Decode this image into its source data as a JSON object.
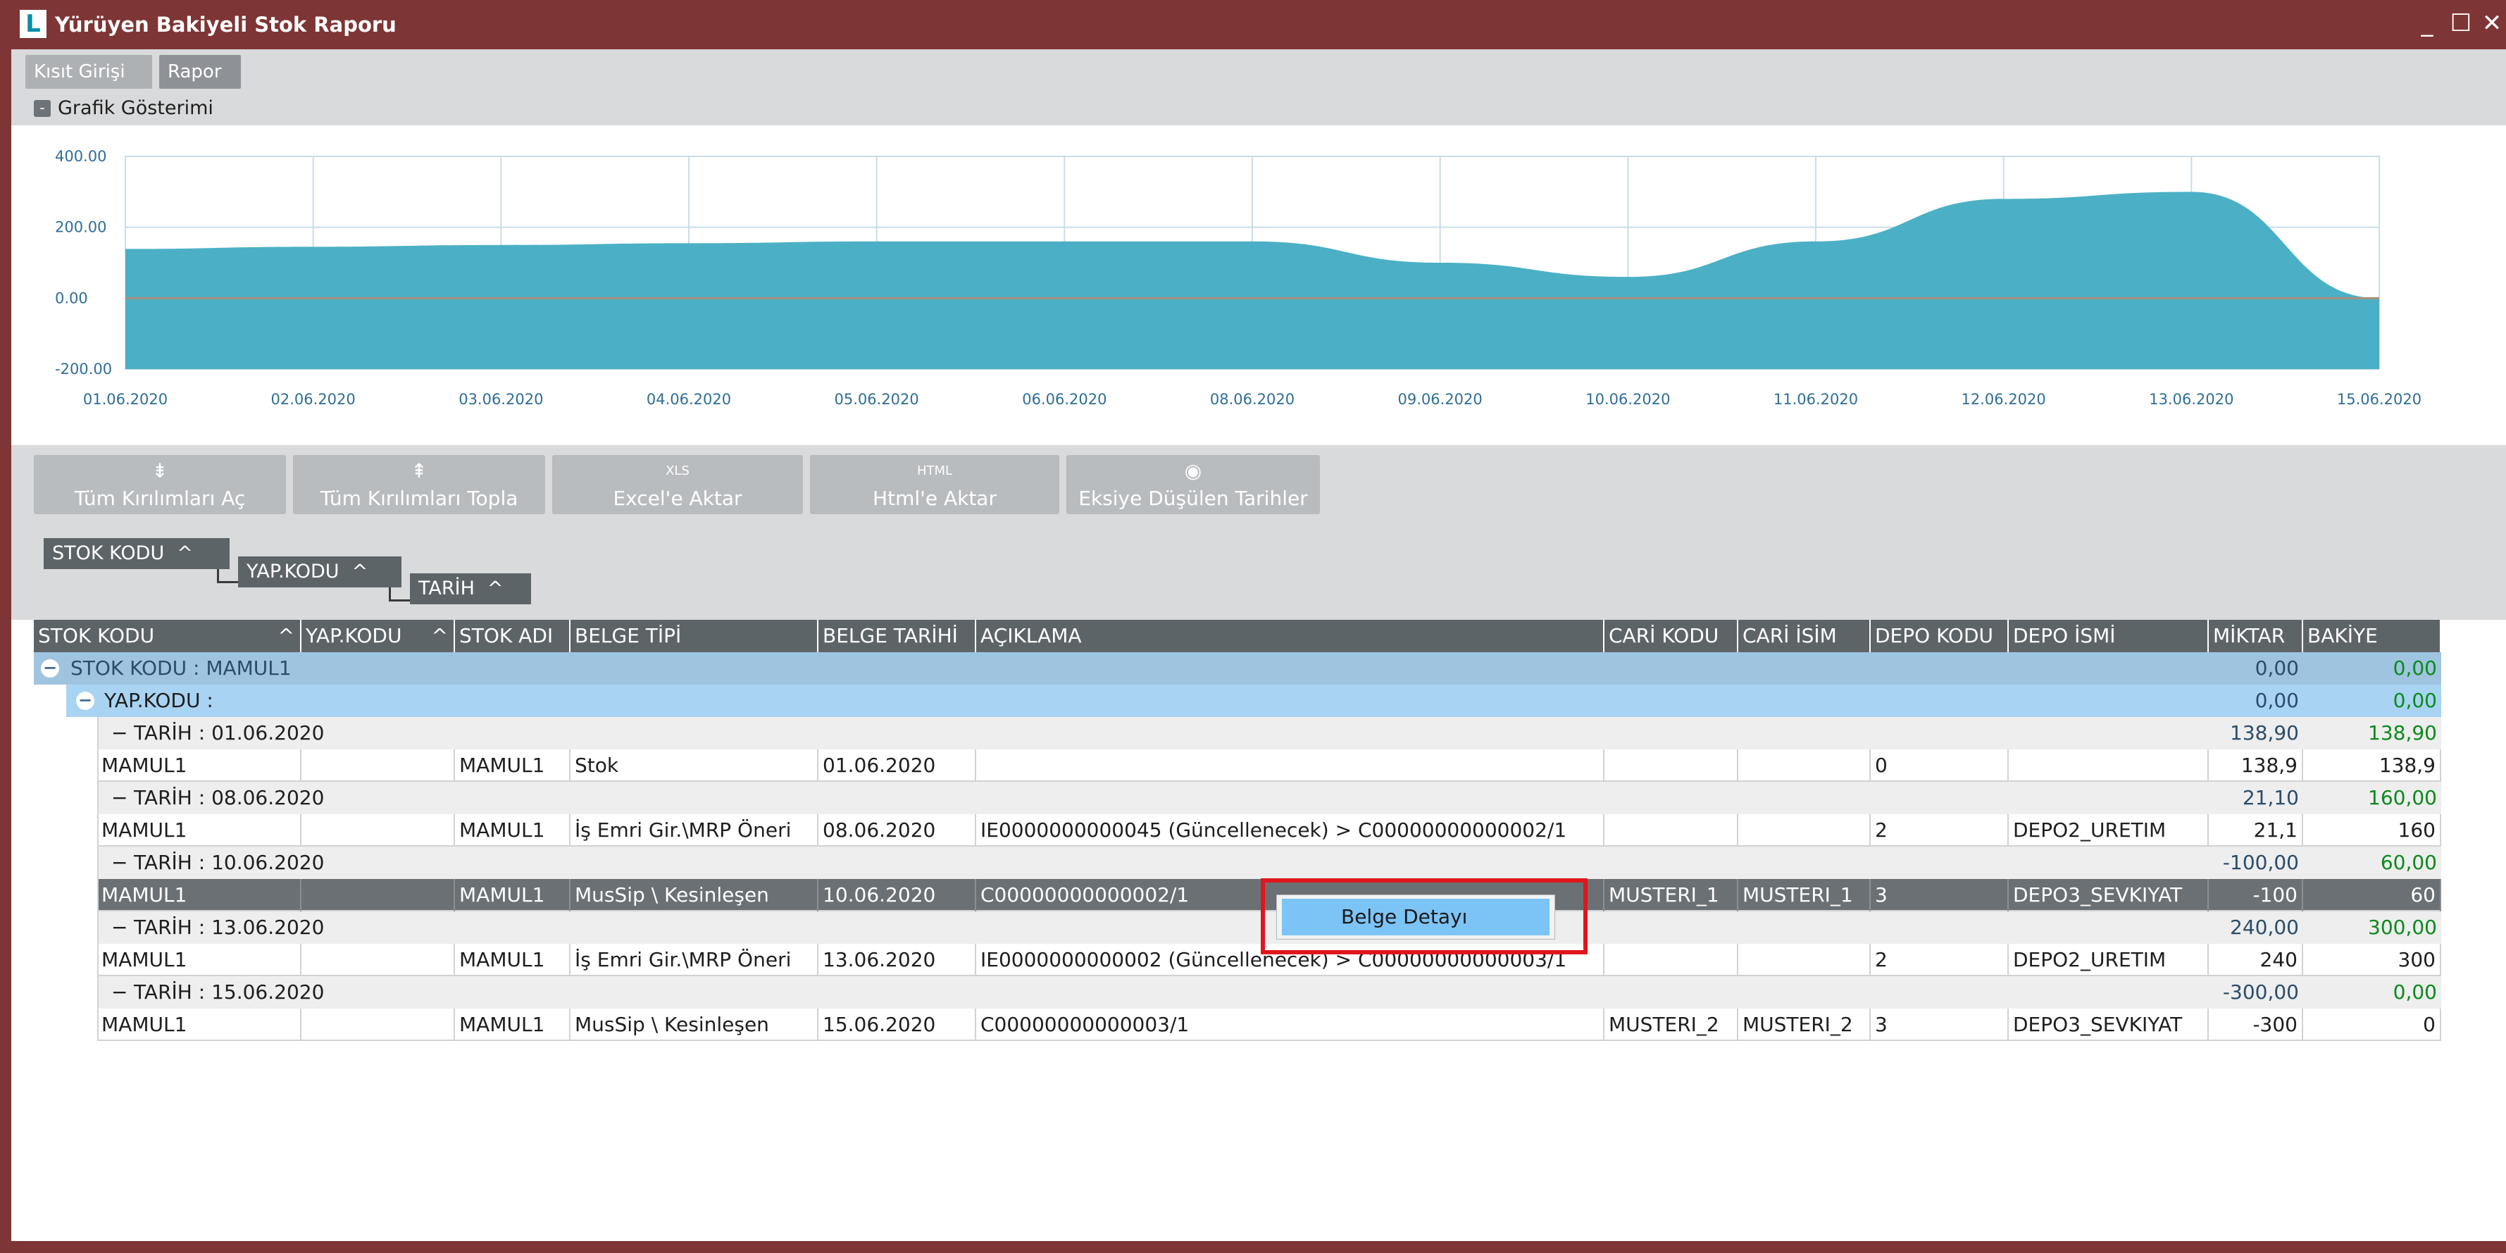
{
  "window": {
    "title": "Yürüyen Bakiyeli Stok Raporu",
    "icon_letter": "L",
    "icon": "app-logo-icon",
    "minimize_glyph": "_",
    "maximize_glyph": "☐",
    "close_glyph": "✕"
  },
  "tabs": [
    {
      "label": "Kısıt Girişi",
      "active": false
    },
    {
      "label": "Rapor",
      "active": true
    }
  ],
  "section": {
    "label": "Grafik Gösterimi",
    "collapse_glyph": "-"
  },
  "chart_data": {
    "type": "area",
    "x": [
      "01.06.2020",
      "02.06.2020",
      "03.06.2020",
      "04.06.2020",
      "05.06.2020",
      "06.06.2020",
      "08.06.2020",
      "09.06.2020",
      "10.06.2020",
      "11.06.2020",
      "12.06.2020",
      "13.06.2020",
      "15.06.2020"
    ],
    "yticks": [
      "400.00",
      "200.00",
      "0.00",
      "-200.00"
    ],
    "ylim": [
      -200,
      400
    ],
    "values": [
      138.9,
      145,
      150,
      155,
      160,
      160,
      160,
      100,
      60,
      160,
      280,
      300,
      0
    ],
    "colors": {
      "area": "#4bb0c5",
      "zero_line": "#a8917a",
      "grid": "#c9ddea"
    },
    "grid": true
  },
  "toolbar": [
    {
      "label": "Tüm Kırılımları Aç",
      "icon": "expand-tree-icon",
      "glyph": "⇟"
    },
    {
      "label": "Tüm Kırılımları Topla",
      "icon": "collapse-tree-icon",
      "glyph": "⇞"
    },
    {
      "label": "Excel'e Aktar",
      "icon": "xls-icon",
      "glyph": "XLS"
    },
    {
      "label": "Html'e Aktar",
      "icon": "html-icon",
      "glyph": "HTML"
    },
    {
      "label": "Eksiye Düşülen Tarihler",
      "icon": "eye-icon",
      "glyph": "◉"
    }
  ],
  "groupby": [
    {
      "label": "STOK KODU",
      "caret": "^"
    },
    {
      "label": "YAP.KODU",
      "caret": "^"
    },
    {
      "label": "TARİH",
      "caret": "^"
    }
  ],
  "grid": {
    "headers": [
      "STOK KODU",
      "YAP.KODU",
      "STOK ADI",
      "BELGE TİPİ",
      "BELGE TARİHİ",
      "AÇIKLAMA",
      "CARİ KODU",
      "CARİ İSİM",
      "DEPO KODU",
      "DEPO İSMİ",
      "MİKTAR",
      "BAKİYE"
    ],
    "header_carets": [
      "^",
      "^"
    ],
    "group1": {
      "label": "STOK KODU : MAMUL1",
      "miktar": "0,00",
      "bakiye": "0,00"
    },
    "group2": {
      "label": "YAP.KODU :",
      "miktar": "0,00",
      "bakiye": "0,00"
    },
    "date_groups": [
      {
        "label": "TARİH : 01.06.2020",
        "miktar": "138,90",
        "bakiye": "138,90",
        "row": {
          "stok_kodu": "MAMUL1",
          "yap_kodu": "",
          "stok_adi": "MAMUL1",
          "belge_tipi": "Stok",
          "belge_tarihi": "01.06.2020",
          "aciklama": "",
          "cari_kodu": "",
          "cari_isim": "",
          "depo_kodu": "0",
          "depo_ismi": "",
          "miktar": "138,9",
          "bakiye": "138,9",
          "selected": false
        }
      },
      {
        "label": "TARİH : 08.06.2020",
        "miktar": "21,10",
        "bakiye": "160,00",
        "row": {
          "stok_kodu": "MAMUL1",
          "yap_kodu": "",
          "stok_adi": "MAMUL1",
          "belge_tipi": "İş Emri Gir.\\MRP Öneri",
          "belge_tarihi": "08.06.2020",
          "aciklama": "IE0000000000045 (Güncellenecek) > C00000000000002/1",
          "cari_kodu": "",
          "cari_isim": "",
          "depo_kodu": "2",
          "depo_ismi": "DEPO2_URETIM",
          "miktar": "21,1",
          "bakiye": "160",
          "selected": false
        }
      },
      {
        "label": "TARİH : 10.06.2020",
        "miktar": "-100,00",
        "bakiye": "60,00",
        "row": {
          "stok_kodu": "MAMUL1",
          "yap_kodu": "",
          "stok_adi": "MAMUL1",
          "belge_tipi": "MusSip \\ Kesinleşen",
          "belge_tarihi": "10.06.2020",
          "aciklama": "C00000000000002/1",
          "cari_kodu": "MUSTERI_1",
          "cari_isim": "MUSTERI_1",
          "depo_kodu": "3",
          "depo_ismi": "DEPO3_SEVKIYAT",
          "miktar": "-100",
          "bakiye": "60",
          "selected": true
        }
      },
      {
        "label": "TARİH : 13.06.2020",
        "miktar": "240,00",
        "bakiye": "300,00",
        "row": {
          "stok_kodu": "MAMUL1",
          "yap_kodu": "",
          "stok_adi": "MAMUL1",
          "belge_tipi": "İş Emri Gir.\\MRP Öneri",
          "belge_tarihi": "13.06.2020",
          "aciklama": "IE0000000000002 (Güncellenecek) > C00000000000003/1",
          "cari_kodu": "",
          "cari_isim": "",
          "depo_kodu": "2",
          "depo_ismi": "DEPO2_URETIM",
          "miktar": "240",
          "bakiye": "300",
          "selected": false
        }
      },
      {
        "label": "TARİH : 15.06.2020",
        "miktar": "-300,00",
        "bakiye": "0,00",
        "row": {
          "stok_kodu": "MAMUL1",
          "yap_kodu": "",
          "stok_adi": "MAMUL1",
          "belge_tipi": "MusSip \\ Kesinleşen",
          "belge_tarihi": "15.06.2020",
          "aciklama": "C00000000000003/1",
          "cari_kodu": "MUSTERI_2",
          "cari_isim": "MUSTERI_2",
          "depo_kodu": "3",
          "depo_ismi": "DEPO3_SEVKIYAT",
          "miktar": "-300",
          "bakiye": "0",
          "selected": false
        }
      }
    ],
    "expander_glyph": "−",
    "date_glyph": "−"
  },
  "context_menu": {
    "items": [
      "Belge Detayı"
    ]
  },
  "colors": {
    "window": "#7e3535",
    "header": "#5d6468",
    "group1": "#9fc4e0",
    "group2": "#a9d3f2",
    "selected_row": "#6a7074",
    "positive_balance": "#0c8a1b",
    "highlight": "#e0161c"
  }
}
